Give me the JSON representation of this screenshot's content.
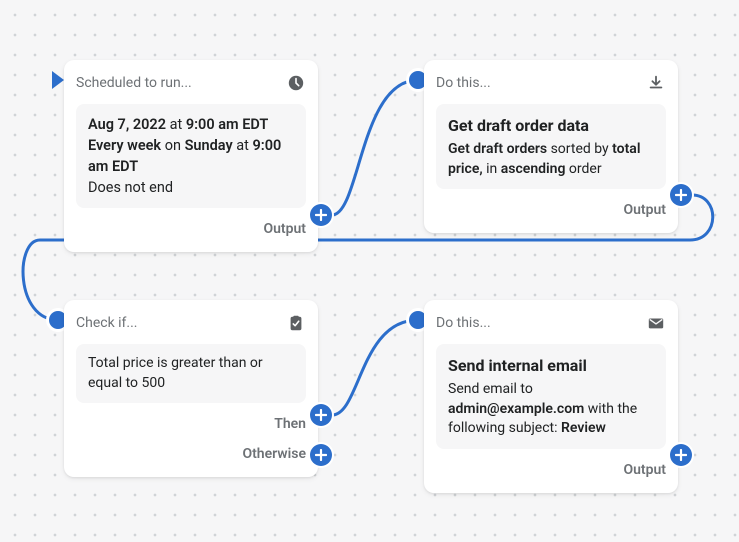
{
  "nodes": {
    "trigger": {
      "header": "Scheduled to run...",
      "start_prefix": "",
      "start_date": "Aug 7, 2022",
      "at1": " at ",
      "start_time": "9:00 am EDT",
      "recur_prefix": "Every week",
      "on": " on ",
      "recur_day": "Sunday",
      "at2": " at ",
      "recur_time": "9:00 am EDT",
      "end_text": "Does not end",
      "output_label": "Output"
    },
    "action1": {
      "header": "Do this...",
      "title": "Get draft order data",
      "seg1": "Get draft orders",
      "seg2": " sorted by ",
      "seg3": "total price,",
      "seg4": " in ",
      "seg5": "ascending",
      "seg6": " order",
      "output_label": "Output"
    },
    "condition": {
      "header": "Check if...",
      "body": "Total price is greater than or equal to 500",
      "then_label": "Then",
      "otherwise_label": "Otherwise"
    },
    "action2": {
      "header": "Do this...",
      "title": "Send internal email",
      "seg1": "Send email to ",
      "seg2": "admin@example.com",
      "seg3": " with the following subject: ",
      "seg4": "Review",
      "output_label": "Output"
    }
  }
}
